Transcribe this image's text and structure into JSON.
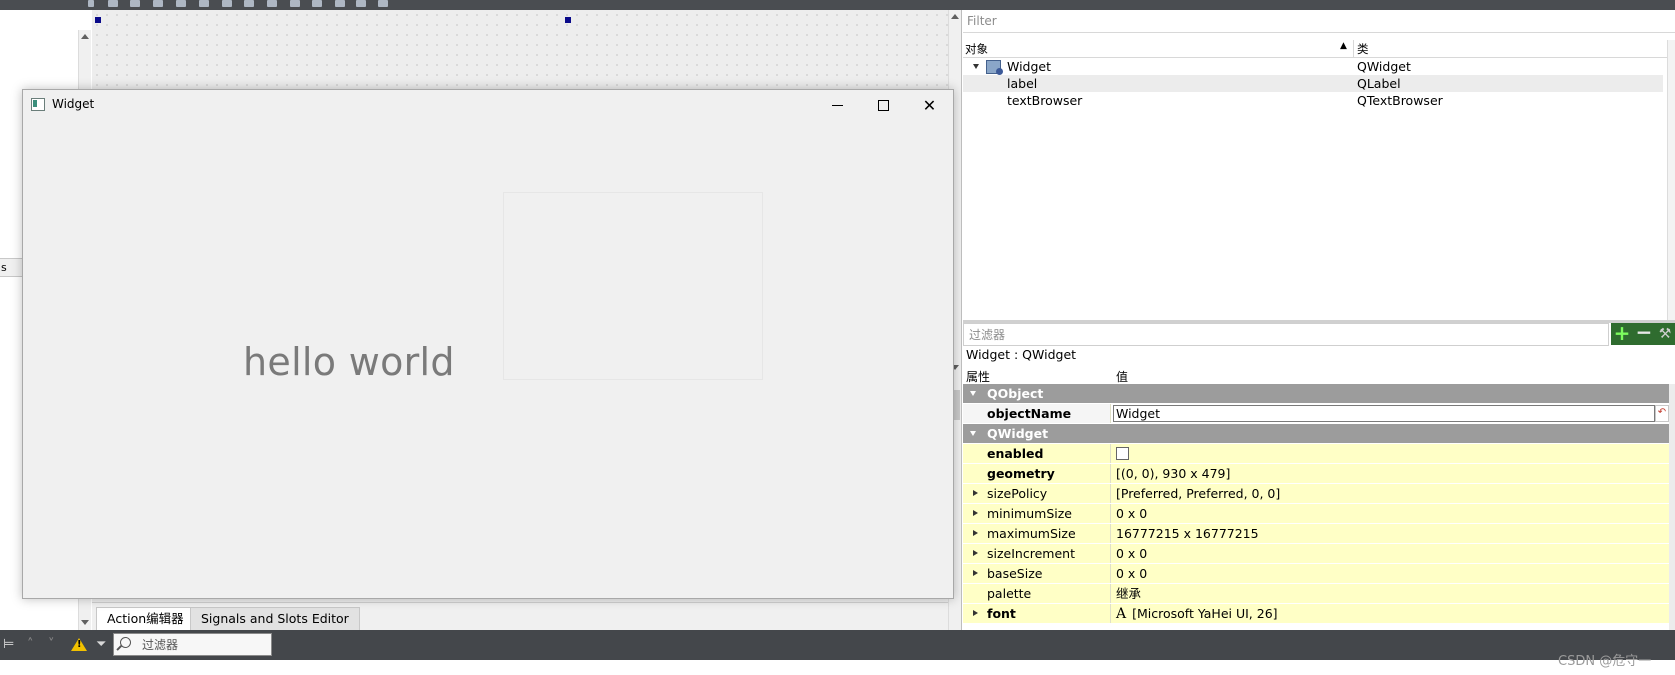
{
  "preview_window": {
    "title": "Widget",
    "label_text": "hello world"
  },
  "left_panel": {
    "tab_fragment": "s"
  },
  "bottom_tabs": {
    "action_editor": "Action编辑器",
    "signals_slots": "Signals and Slots Editor"
  },
  "object_inspector": {
    "filter_placeholder": "Filter",
    "col_object": "对象",
    "col_class": "类",
    "rows": [
      {
        "name": "Widget",
        "class": "QWidget"
      },
      {
        "name": "label",
        "class": "QLabel"
      },
      {
        "name": "textBrowser",
        "class": "QTextBrowser"
      }
    ]
  },
  "property_editor": {
    "filter_placeholder": "过滤器",
    "add_symbol": "+",
    "remove_symbol": "−",
    "class_title": "Widget : QWidget",
    "col_property": "属性",
    "col_value": "值",
    "groups": {
      "qobject": "QObject",
      "qwidget": "QWidget"
    },
    "props": {
      "objectName": {
        "name": "objectName",
        "value": "Widget"
      },
      "enabled": {
        "name": "enabled"
      },
      "geometry": {
        "name": "geometry",
        "value": "[(0, 0), 930 x 479]"
      },
      "sizePolicy": {
        "name": "sizePolicy",
        "value": "[Preferred, Preferred, 0, 0]"
      },
      "minimumSize": {
        "name": "minimumSize",
        "value": "0 x 0"
      },
      "maximumSize": {
        "name": "maximumSize",
        "value": "16777215 x 16777215"
      },
      "sizeIncrement": {
        "name": "sizeIncrement",
        "value": "0 x 0"
      },
      "baseSize": {
        "name": "baseSize",
        "value": "0 x 0"
      },
      "palette": {
        "name": "palette",
        "value": "继承"
      },
      "font": {
        "name": "font",
        "value": "[Microsoft YaHei UI, 26]"
      }
    }
  },
  "statusbar": {
    "filter_placeholder": "过滤器",
    "watermark": "CSDN @危守一"
  },
  "colors": {
    "group_header": "#9c9c9c",
    "changed_property_bg": "#ffffc6",
    "statusbar": "#44474b",
    "warning": "#f2c100"
  }
}
